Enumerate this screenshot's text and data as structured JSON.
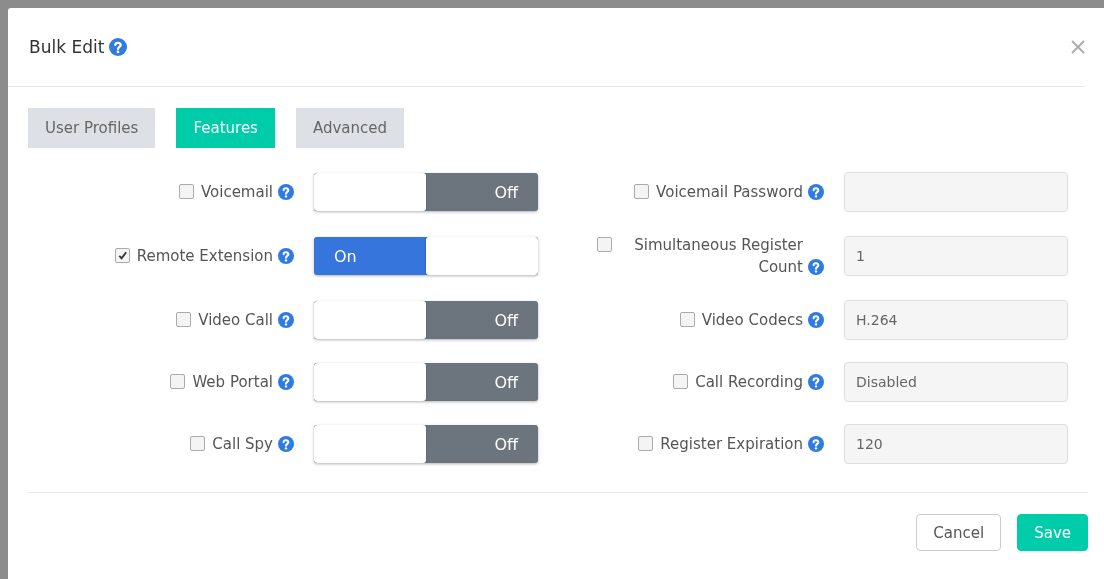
{
  "dialog": {
    "title": "Bulk Edit"
  },
  "tabs": [
    {
      "label": "User Profiles",
      "selected": false
    },
    {
      "label": "Features",
      "selected": true
    },
    {
      "label": "Advanced",
      "selected": false
    }
  ],
  "features": [
    {
      "label": "Voicemail",
      "checked": false,
      "toggle": {
        "text": "Off",
        "on": false
      }
    },
    {
      "label": "Remote Extension",
      "checked": true,
      "toggle": {
        "text": "On",
        "on": true
      }
    },
    {
      "label": "Video Call",
      "checked": false,
      "toggle": {
        "text": "Off",
        "on": false
      }
    },
    {
      "label": "Web Portal",
      "checked": false,
      "toggle": {
        "text": "Off",
        "on": false
      }
    },
    {
      "label": "Call Spy",
      "checked": false,
      "toggle": {
        "text": "Off",
        "on": false
      }
    }
  ],
  "settings": [
    {
      "label": "Voicemail Password",
      "checked": false
    },
    {
      "label": "Simultaneous Register Count",
      "checked": false,
      "value": "1"
    },
    {
      "label": "Video Codecs",
      "checked": false,
      "value": "H.264"
    },
    {
      "label": "Call Recording",
      "checked": false,
      "value": "Disabled"
    },
    {
      "label": "Register Expiration",
      "checked": false,
      "value": "120"
    }
  ],
  "buttons": [
    {
      "label": "Cancel",
      "kind": "secondary"
    },
    {
      "label": "Save",
      "kind": "primary"
    }
  ]
}
